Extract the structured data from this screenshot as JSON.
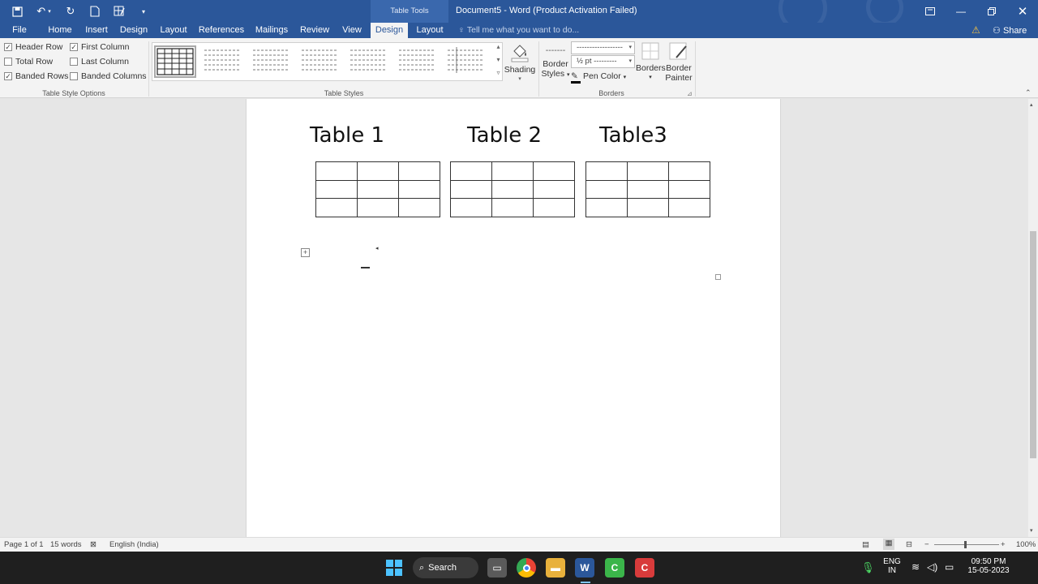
{
  "window": {
    "title": "Document5 - Word (Product Activation Failed)",
    "context_tab": "Table Tools"
  },
  "ribbon_tabs": [
    "File",
    "Home",
    "Insert",
    "Design",
    "Layout",
    "References",
    "Mailings",
    "Review",
    "View",
    "Design",
    "Layout"
  ],
  "tell_me_placeholder": "Tell me what you want to do...",
  "share_label": "Share",
  "table_style_options": {
    "label": "Table Style Options",
    "items": [
      {
        "label": "Header Row",
        "checked": true
      },
      {
        "label": "First Column",
        "checked": true
      },
      {
        "label": "Total Row",
        "checked": false
      },
      {
        "label": "Last Column",
        "checked": false
      },
      {
        "label": "Banded Rows",
        "checked": true
      },
      {
        "label": "Banded Columns",
        "checked": false
      }
    ]
  },
  "table_styles": {
    "label": "Table Styles"
  },
  "shading": {
    "label": "Shading"
  },
  "borders_group": {
    "label": "Borders",
    "border_styles": [
      "Border",
      "Styles"
    ],
    "line_style_value": "------------------",
    "pen_weight_value": "½ pt ---------",
    "pen_color_label": "Pen Color",
    "borders_label": "Borders",
    "border_painter": [
      "Border",
      "Painter"
    ]
  },
  "document": {
    "headings": [
      "Table 1",
      "Table 2",
      "Table3"
    ],
    "table_rows": 3,
    "table_cols": 3
  },
  "statusbar": {
    "page": "Page 1 of 1",
    "words": "15 words",
    "language": "English (India)",
    "zoom": "100%"
  },
  "taskbar": {
    "search_label": "Search",
    "lang_top": "ENG",
    "lang_bottom": "IN",
    "time": "09:50 PM",
    "date": "15-05-2023"
  },
  "colors": {
    "word_blue": "#2b579a",
    "ribbon_bg": "#f3f3f3",
    "page_bg": "#ffffff"
  }
}
